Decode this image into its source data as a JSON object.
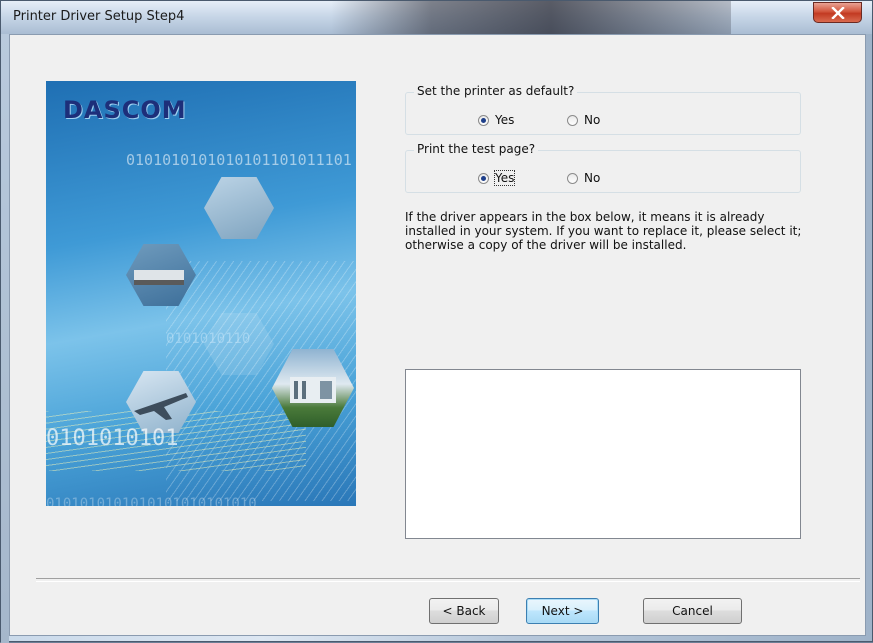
{
  "window": {
    "title": "Printer Driver Setup Step4"
  },
  "banner": {
    "logo": "DASCOM",
    "binary_top": "0101010101010101101011101",
    "binary_mid": "0101010110",
    "binary_low": "0101010101",
    "binary_bottom": "0101010101010101010101010"
  },
  "default_group": {
    "label": "Set the printer as default?",
    "options": [
      {
        "label": "Yes",
        "checked": true
      },
      {
        "label": "No",
        "checked": false
      }
    ]
  },
  "test_group": {
    "label": "Print the test page?",
    "options": [
      {
        "label": "Yes",
        "checked": true
      },
      {
        "label": "No",
        "checked": false
      }
    ]
  },
  "info_text": "If the driver appears in the box below, it means it is already installed in your system. If you want to replace it, please select it; otherwise a copy of the driver will be installed.",
  "buttons": {
    "back": "< Back",
    "next": "Next >",
    "cancel": "Cancel"
  },
  "colors": {
    "accent": "#3c7fb1",
    "close_button": "#c23a22"
  }
}
